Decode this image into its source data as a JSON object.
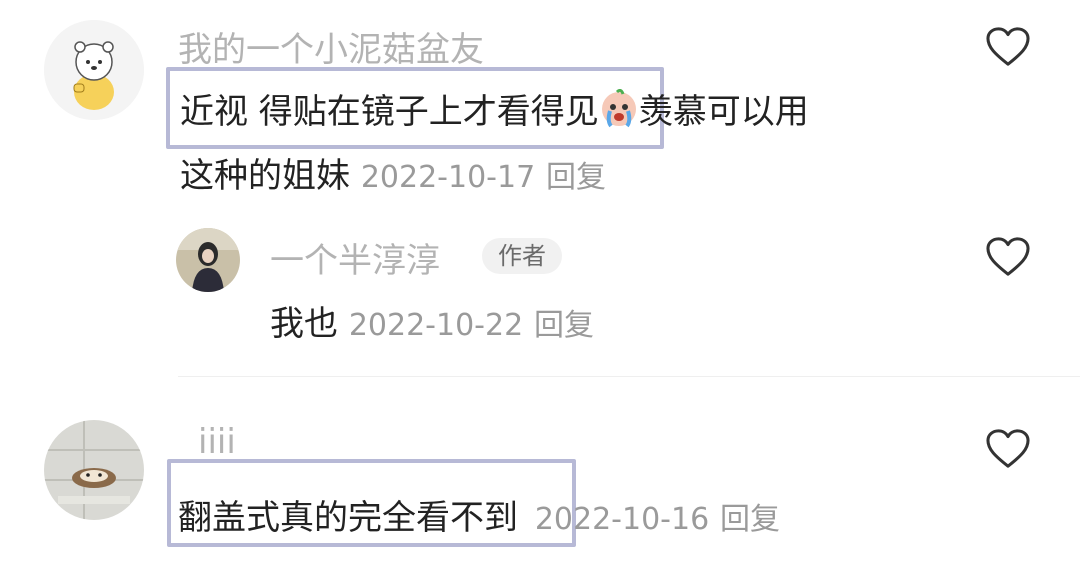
{
  "comments": [
    {
      "username": "我的一个小泥菇盆友",
      "line1_highlight": "近视 得贴在镜子上才看得见",
      "emoji": "crying-face-emoji",
      "line1_rest": "羡慕可以用",
      "line2_text": "这种的姐妹",
      "date": "2022-10-17",
      "reply_label": "回复",
      "like_icon": "heart-outline-icon",
      "replies": [
        {
          "username": "一个半淳淳",
          "badge": "作者",
          "text": "我也",
          "date": "2022-10-22",
          "reply_label": "回复",
          "like_icon": "heart-outline-icon"
        }
      ]
    },
    {
      "username": "iiii",
      "highlight_text": "翻盖式真的完全看不到",
      "date": "2022-10-16",
      "reply_label": "回复",
      "like_icon": "heart-outline-icon"
    }
  ],
  "colors": {
    "highlight_border": "#b7b9d6",
    "username": "#b3b3b3",
    "meta": "#9a9a9a",
    "text": "#222222"
  }
}
